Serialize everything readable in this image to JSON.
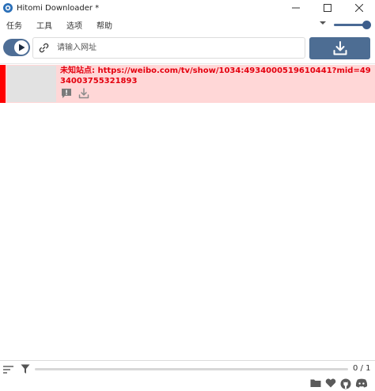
{
  "window": {
    "title": "Hitomi Downloader *",
    "controls": [
      "minimize-icon",
      "maximize-icon",
      "close-icon"
    ]
  },
  "menu": {
    "items": [
      "任务",
      "工具",
      "选项",
      "帮助"
    ]
  },
  "toolbar": {
    "url_placeholder": "请输入网址",
    "url_value": "",
    "download_icon": "download-icon",
    "slider_level": 0.8
  },
  "tasks": [
    {
      "text": "未知站点: https://weibo.com/tv/show/1034:4934000519610441?mid=4934003755321893",
      "status": "error",
      "icons": [
        "error-icon",
        "download-icon"
      ]
    }
  ],
  "status": {
    "count": "0 / 1",
    "progress": 0.0
  },
  "colors": {
    "accent": "#4d6d93",
    "error_bg": "#ffd7d7",
    "error_text": "#e4000f",
    "error_bar": "#ff0000"
  },
  "footer_icons": [
    "folder-icon",
    "heart-icon",
    "github-icon",
    "discord-icon"
  ]
}
